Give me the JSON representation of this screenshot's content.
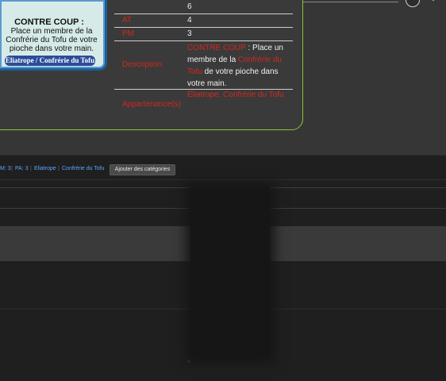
{
  "card": {
    "title": "CONTRE COUP :",
    "text": "Place un membre de la Confrérie du Tofu de votre pioche dans votre main.",
    "footer": "Eliatrope / Confrérie du Tofu"
  },
  "stats": {
    "row0": {
      "label": "",
      "value": "6"
    },
    "at": {
      "label": "AT",
      "value": "4"
    },
    "pm": {
      "label": "PM",
      "value": "3"
    },
    "description": {
      "label": "Description",
      "keyword": "CONTRE COUP",
      "part1": " : Place un membre de la ",
      "highlight": "Confrérie du Tofu",
      "part2": " de votre pioche dans votre main."
    },
    "appartenance": {
      "label": "Appartenance(s)",
      "value1": "Eliatrope",
      "value2": "Confrérie du Tofu"
    }
  },
  "categories": {
    "items": [
      "M: 3",
      "PA: 3",
      "Eliatrope",
      "Confrérie du Tofu"
    ],
    "add_button": "Ajouter des catégories"
  },
  "colors": {
    "accent_green": "#8fc33a",
    "label_red": "#d0281e",
    "link_blue": "#5aa7ff"
  }
}
